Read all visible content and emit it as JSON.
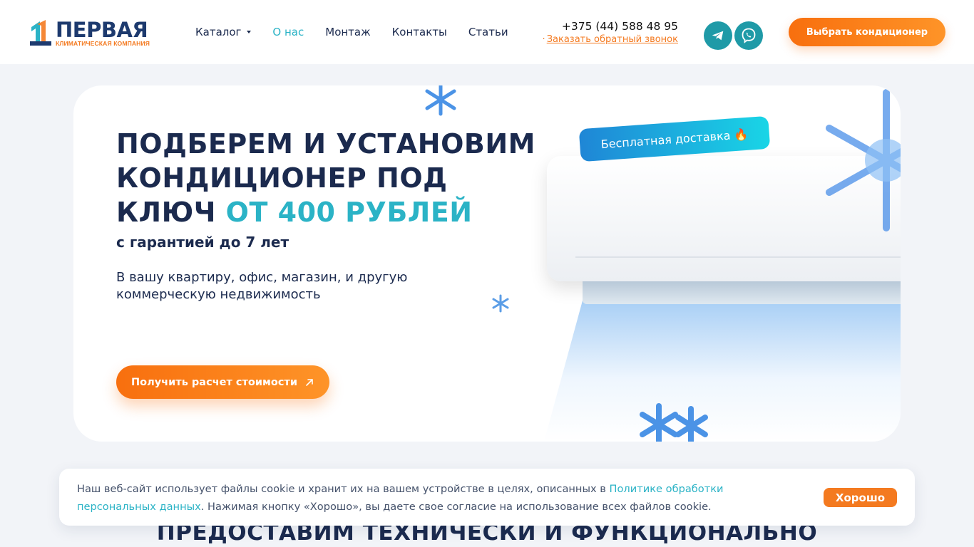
{
  "logo": {
    "title": "ПЕРВАЯ",
    "subtitle": "КЛИМАТИЧЕСКАЯ КОМПАНИЯ"
  },
  "nav": {
    "items": [
      {
        "label": "Каталог",
        "has_dropdown": true,
        "active": false
      },
      {
        "label": "О нас",
        "active": true
      },
      {
        "label": "Монтаж",
        "active": false
      },
      {
        "label": "Контакты",
        "active": false
      },
      {
        "label": "Статьи",
        "active": false
      }
    ]
  },
  "contacts": {
    "phone": "+375 (44) 588 48 95",
    "callback": "Заказать обратный звонок"
  },
  "social": {
    "telegram_icon": "telegram-icon",
    "viber_icon": "viber-icon"
  },
  "header_button": "Выбрать кондиционер",
  "hero": {
    "title_line1": "ПОДБЕРЕМ И УСТАНОВИМ",
    "title_line2": "КОНДИЦИОНЕР ПОД",
    "title_line3_plain": "КЛЮЧ ",
    "title_line3_accent": "ОТ 400 РУБЛЕЙ",
    "subtitle": "с гарантией до 7 лет",
    "description": "В вашу квартиру, офис, магазин, и другую коммерческую недвижимость",
    "cta": "Получить расчет стоимости",
    "badge": "Бесплатная доставка 🔥"
  },
  "cookie": {
    "text_before": "Наш веб-сайт использует файлы cookie и хранит их на вашем устройстве в целях, описанных в ",
    "link": "Политике обработки персональных данных",
    "text_after": ". Нажимая кнопку «Хорошо», вы даете свое согласие на использование всех файлов cookie.",
    "button": "Хорошо"
  },
  "section_title": "ПРЕДОСТАВИМ ТЕХНИЧЕСКИ И ФУНКЦИОНАЛЬНО",
  "colors": {
    "accent": "#2bb3c6",
    "orange": "#f47a20",
    "navy": "#1b2a4e"
  }
}
